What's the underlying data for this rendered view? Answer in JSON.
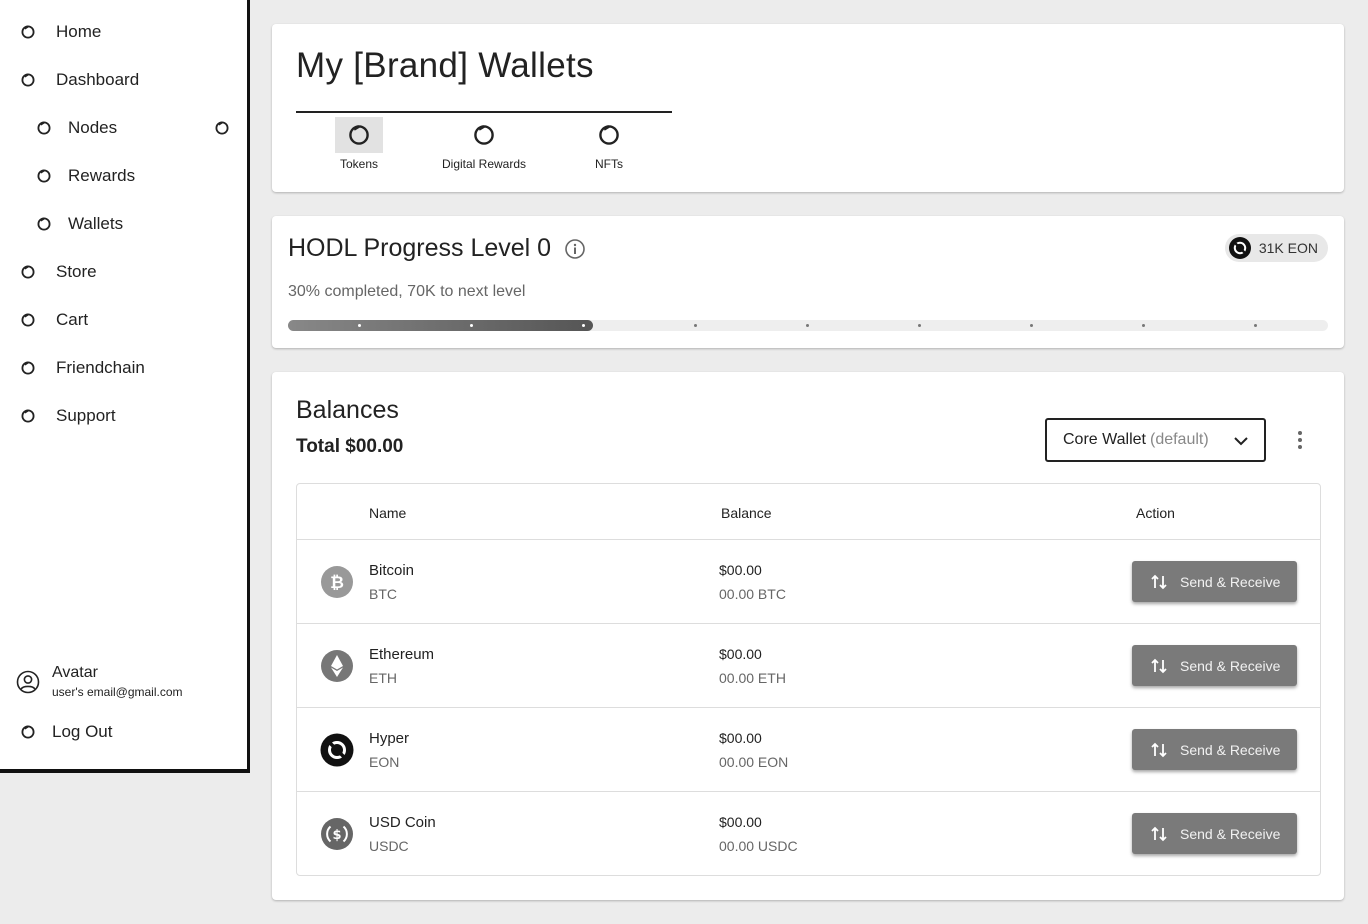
{
  "sidebar": {
    "items": [
      {
        "label": "Home"
      },
      {
        "label": "Dashboard"
      },
      {
        "label": "Nodes"
      },
      {
        "label": "Rewards"
      },
      {
        "label": "Wallets"
      },
      {
        "label": "Store"
      },
      {
        "label": "Cart"
      },
      {
        "label": "Friendchain"
      },
      {
        "label": "Support"
      }
    ],
    "profile": {
      "name": "Avatar",
      "email": "user's email@gmail.com"
    },
    "logout_label": "Log Out"
  },
  "header": {
    "title": "My [Brand] Wallets",
    "tabs": [
      {
        "label": "Tokens",
        "active": true
      },
      {
        "label": "Digital Rewards",
        "active": false
      },
      {
        "label": "NFTs",
        "active": false
      }
    ]
  },
  "hodl": {
    "title": "HODL Progress Level 0",
    "chip": "31K EON",
    "subtitle": "30% completed, 70K to next level",
    "progress": 0.3
  },
  "balances": {
    "title": "Balances",
    "total": "Total $00.00",
    "wallet_name": "Core Wallet",
    "wallet_hint": "(default)",
    "columns": {
      "name": "Name",
      "balance": "Balance",
      "action": "Action"
    },
    "rows": [
      {
        "name": "Bitcoin",
        "symbol": "BTC",
        "usd": "$00.00",
        "amount": "00.00 BTC",
        "action": "Send & Receive",
        "icon": "bitcoin-icon"
      },
      {
        "name": "Ethereum",
        "symbol": "ETH",
        "usd": "$00.00",
        "amount": "00.00 ETH",
        "action": "Send & Receive",
        "icon": "ethereum-icon"
      },
      {
        "name": "Hyper",
        "symbol": "EON",
        "usd": "$00.00",
        "amount": "00.00 EON",
        "action": "Send & Receive",
        "icon": "hyper-icon"
      },
      {
        "name": "USD Coin",
        "symbol": "USDC",
        "usd": "$00.00",
        "amount": "00.00 USDC",
        "action": "Send & Receive",
        "icon": "usd-coin-icon"
      }
    ]
  },
  "colors": {
    "accent": "#7a7a7a",
    "background": "#ececec",
    "text": "#222222"
  }
}
